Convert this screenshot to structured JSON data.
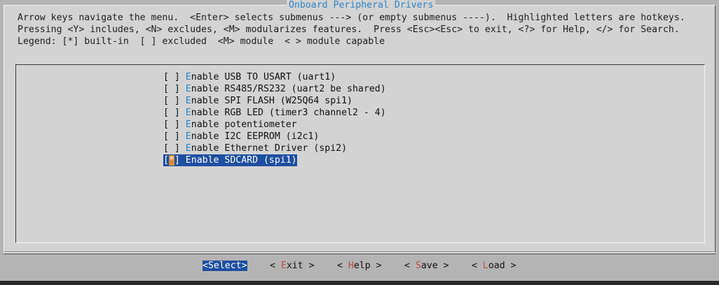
{
  "title": "Onboard Peripheral Drivers",
  "help_lines": [
    "Arrow keys navigate the menu.  <Enter> selects submenus ---> (or empty submenus ----).  Highlighted letters are hotkeys.",
    "Pressing <Y> includes, <N> excludes, <M> modularizes features.  Press <Esc><Esc> to exit, <?> for Help, </> for Search.",
    "Legend: [*] built-in  [ ] excluded  <M> module  < > module capable"
  ],
  "menu_items": [
    {
      "state": " ",
      "hotkey": "E",
      "rest": "nable USB TO USART (uart1)",
      "selected": false
    },
    {
      "state": " ",
      "hotkey": "E",
      "rest": "nable RS485/RS232 (uart2 be shared)",
      "selected": false
    },
    {
      "state": " ",
      "hotkey": "E",
      "rest": "nable SPI FLASH (W25Q64 spi1)",
      "selected": false
    },
    {
      "state": " ",
      "hotkey": "E",
      "rest": "nable RGB LED (timer3 channel2 - 4)",
      "selected": false
    },
    {
      "state": " ",
      "hotkey": "E",
      "rest": "nable potentiometer",
      "selected": false
    },
    {
      "state": " ",
      "hotkey": "E",
      "rest": "nable I2C EEPROM (i2c1)",
      "selected": false
    },
    {
      "state": " ",
      "hotkey": "E",
      "rest": "nable Ethernet Driver (spi2)",
      "selected": false
    },
    {
      "state": "*",
      "hotkey": "E",
      "rest": "nable SDCARD (spi1)",
      "selected": true
    }
  ],
  "buttons": [
    {
      "pre": "<",
      "hotkey": "S",
      "rest": "elect",
      "post": ">",
      "active": true
    },
    {
      "pre": "< ",
      "hotkey": "E",
      "rest": "xit",
      "post": " >",
      "active": false
    },
    {
      "pre": "< ",
      "hotkey": "H",
      "rest": "elp",
      "post": " >",
      "active": false
    },
    {
      "pre": "< ",
      "hotkey": "S",
      "rest": "ave",
      "post": " >",
      "active": false
    },
    {
      "pre": "< ",
      "hotkey": "L",
      "rest": "oad",
      "post": " >",
      "active": false
    }
  ],
  "colors": {
    "accent": "#2d84c7",
    "selection": "#1e4fa0",
    "button_hotkey": "#c34a4a",
    "dialog_bg": "#d3d3d3"
  }
}
